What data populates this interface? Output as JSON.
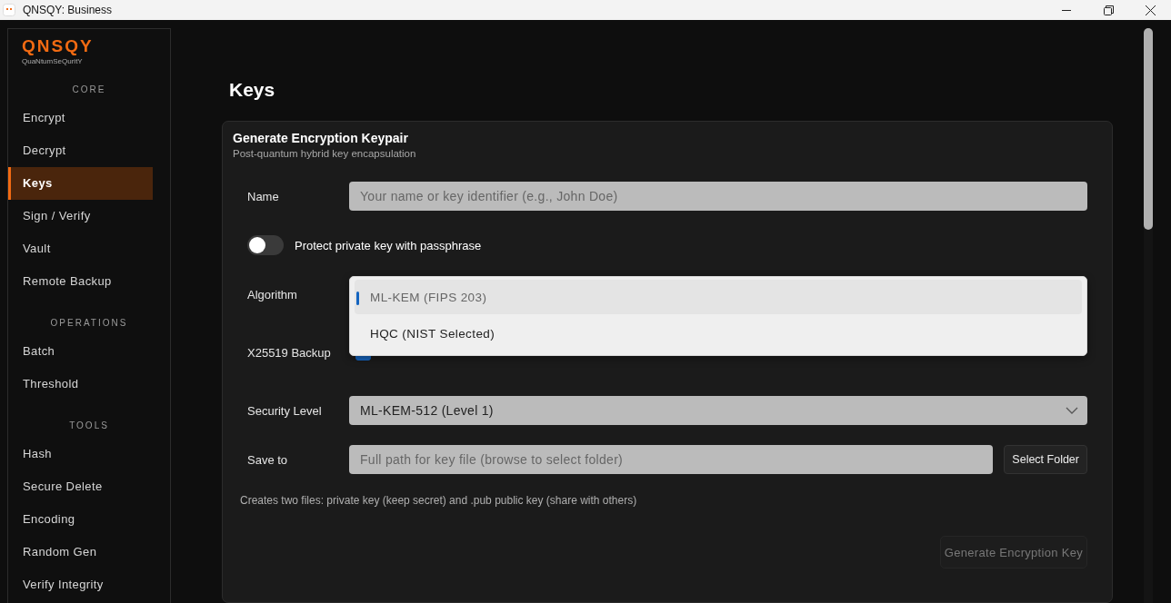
{
  "window": {
    "title": "QNSQY: Business"
  },
  "sidebar": {
    "logo": "QNSQY",
    "tagline": "QuaNtumSeQuritY",
    "sections": [
      {
        "heading": "CORE",
        "items": [
          {
            "label": "Encrypt",
            "selected": false
          },
          {
            "label": "Decrypt",
            "selected": false
          },
          {
            "label": "Keys",
            "selected": true
          },
          {
            "label": "Sign / Verify",
            "selected": false
          },
          {
            "label": "Vault",
            "selected": false
          },
          {
            "label": "Remote Backup",
            "selected": false
          }
        ]
      },
      {
        "heading": "OPERATIONS",
        "items": [
          {
            "label": "Batch",
            "selected": false
          },
          {
            "label": "Threshold",
            "selected": false
          }
        ]
      },
      {
        "heading": "TOOLS",
        "items": [
          {
            "label": "Hash",
            "selected": false
          },
          {
            "label": "Secure Delete",
            "selected": false
          },
          {
            "label": "Encoding",
            "selected": false
          },
          {
            "label": "Random Gen",
            "selected": false
          },
          {
            "label": "Verify Integrity",
            "selected": false
          }
        ]
      }
    ]
  },
  "page": {
    "title": "Keys"
  },
  "card": {
    "title": "Generate Encryption Keypair",
    "subtitle": "Post-quantum hybrid key encapsulation",
    "fields": [
      {
        "kind": "text",
        "label": "Name",
        "placeholder": "Your name or key identifier (e.g., John Doe)"
      },
      {
        "kind": "toggle",
        "label": "Protect private key with passphrase",
        "on": false
      },
      {
        "kind": "dropdown",
        "label": "Algorithm",
        "expanded": true,
        "options": [
          {
            "label": "ML-KEM (FIPS 203)",
            "selected": true
          },
          {
            "label": "HQC (NIST Selected)",
            "selected": false
          }
        ]
      },
      {
        "kind": "checkbox",
        "label": "X25519 Backup",
        "checked": true
      },
      {
        "kind": "select",
        "label": "Security Level",
        "value": "ML-KEM-512 (Level 1)"
      },
      {
        "kind": "path",
        "label": "Save to",
        "placeholder": "Full path for key file (browse to select folder)",
        "button": "Select Folder"
      }
    ],
    "note": "Creates two files: private key (keep secret) and .pub public key (share with others)",
    "action": {
      "label": "Generate Encryption Key",
      "disabled": true
    }
  }
}
